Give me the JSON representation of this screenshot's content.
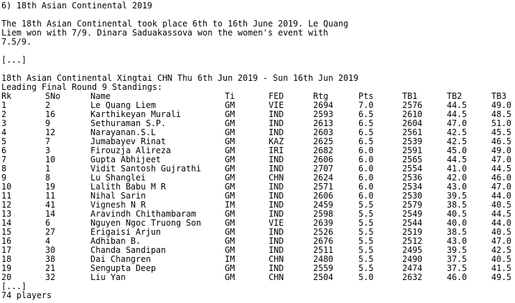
{
  "heading": "6) 18th Asian Continental 2019",
  "intro": [
    "The 18th Asian Continental took place 6th to 16th June 2019. Le Quang",
    "Liem won with 7/9. Dinara Saduakassova won the women's event with",
    "7.5/9."
  ],
  "ellipsis": "[...]",
  "event_line": "18th Asian Continental Xingtai CHN Thu 6th Jun 2019 - Sun 16th Jun 2019",
  "standings_title": "Leading Final Round 9 Standings:",
  "columns": [
    "Rk",
    "SNo",
    "Name",
    "Ti",
    "FED",
    "Rtg",
    "Pts",
    "TB1",
    "TB2",
    "TB3"
  ],
  "rows": [
    [
      "1",
      "2",
      "Le Quang Liem",
      "GM",
      "VIE",
      "2694",
      "7.0",
      "2576",
      "44.5",
      "49.0"
    ],
    [
      "2",
      "16",
      "Karthikeyan Murali",
      "GM",
      "IND",
      "2593",
      "6.5",
      "2610",
      "44.5",
      "48.5"
    ],
    [
      "3",
      "9",
      "Sethuraman S.P.",
      "GM",
      "IND",
      "2613",
      "6.5",
      "2604",
      "47.0",
      "51.0"
    ],
    [
      "4",
      "12",
      "Narayanan.S.L",
      "GM",
      "IND",
      "2603",
      "6.5",
      "2561",
      "42.5",
      "45.5"
    ],
    [
      "5",
      "7",
      "Jumabayev Rinat",
      "GM",
      "KAZ",
      "2625",
      "6.5",
      "2539",
      "42.5",
      "46.5"
    ],
    [
      "6",
      "3",
      "Firouzja Alireza",
      "GM",
      "IRI",
      "2682",
      "6.0",
      "2591",
      "45.0",
      "49.0"
    ],
    [
      "7",
      "10",
      "Gupta Abhijeet",
      "GM",
      "IND",
      "2606",
      "6.0",
      "2565",
      "44.5",
      "47.0"
    ],
    [
      "8",
      "1",
      "Vidit Santosh Gujrathi",
      "GM",
      "IND",
      "2707",
      "6.0",
      "2554",
      "41.0",
      "44.5"
    ],
    [
      "9",
      "8",
      "Lu Shanglei",
      "GM",
      "CHN",
      "2624",
      "6.0",
      "2536",
      "42.0",
      "46.0"
    ],
    [
      "10",
      "19",
      "Lalith Babu M R",
      "GM",
      "IND",
      "2571",
      "6.0",
      "2534",
      "43.0",
      "47.0"
    ],
    [
      "11",
      "11",
      "Nihal Sarin",
      "GM",
      "IND",
      "2606",
      "6.0",
      "2530",
      "39.5",
      "44.0"
    ],
    [
      "12",
      "41",
      "Vignesh N R",
      "IM",
      "IND",
      "2459",
      "5.5",
      "2579",
      "38.5",
      "40.5"
    ],
    [
      "13",
      "14",
      "Aravindh Chithambaram",
      "GM",
      "IND",
      "2598",
      "5.5",
      "2549",
      "40.5",
      "44.5"
    ],
    [
      "14",
      "6",
      "Nguyen Ngoc Truong Son",
      "GM",
      "VIE",
      "2639",
      "5.5",
      "2544",
      "40.0",
      "44.0"
    ],
    [
      "15",
      "27",
      "Erigaisi Arjun",
      "GM",
      "IND",
      "2526",
      "5.5",
      "2519",
      "38.5",
      "40.5"
    ],
    [
      "16",
      "4",
      "Adhiban B.",
      "GM",
      "IND",
      "2676",
      "5.5",
      "2512",
      "43.0",
      "47.0"
    ],
    [
      "17",
      "30",
      "Chanda Sandipan",
      "GM",
      "IND",
      "2511",
      "5.5",
      "2495",
      "39.5",
      "42.5"
    ],
    [
      "18",
      "38",
      "Dai Changren",
      "IM",
      "CHN",
      "2480",
      "5.5",
      "2490",
      "37.5",
      "40.5"
    ],
    [
      "19",
      "21",
      "Sengupta Deep",
      "GM",
      "IND",
      "2559",
      "5.5",
      "2474",
      "37.5",
      "41.5"
    ],
    [
      "20",
      "32",
      "Liu Yan",
      "GM",
      "CHN",
      "2504",
      "5.0",
      "2632",
      "46.0",
      "49.5"
    ]
  ],
  "players_count": "74 players"
}
